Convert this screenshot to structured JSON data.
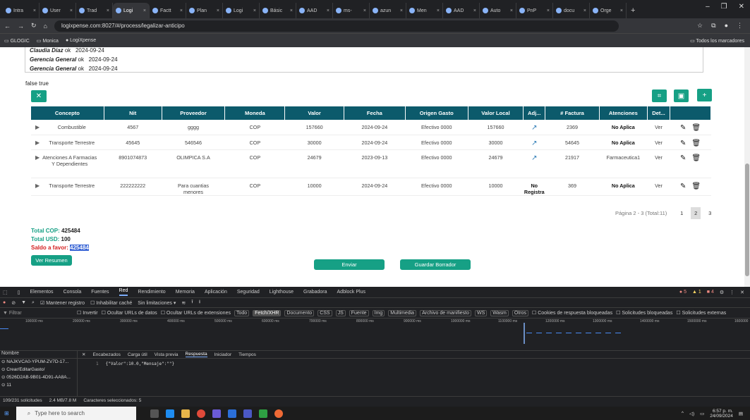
{
  "browser": {
    "tabs": [
      {
        "label": "Intra"
      },
      {
        "label": "User"
      },
      {
        "label": "Trad"
      },
      {
        "label": "Logi",
        "active": true
      },
      {
        "label": "Factt"
      },
      {
        "label": "Plan"
      },
      {
        "label": "Logi"
      },
      {
        "label": "Básic"
      },
      {
        "label": "AAD"
      },
      {
        "label": "ms-"
      },
      {
        "label": "azun"
      },
      {
        "label": "Men"
      },
      {
        "label": "AAD"
      },
      {
        "label": "Auto"
      },
      {
        "label": "PnP"
      },
      {
        "label": "docu"
      },
      {
        "label": "Orge"
      }
    ],
    "new_tab": "+",
    "url": "logixpense.com:8027/#/process/legalizar-anticipo",
    "bookmarks": [
      "GLOGIC",
      "Monica",
      "LogiXpense"
    ],
    "bookmarks_right": "Todos los marcadores"
  },
  "approvals": [
    {
      "name": "Claudia Díaz",
      "status": "ok",
      "date": "2024-09-24"
    },
    {
      "name": "Gerencia General",
      "status": "ok",
      "date": "2024-09-24"
    },
    {
      "name": "Gerencia General",
      "status": "ok",
      "date": "2024-09-24"
    }
  ],
  "flag_text": "false true",
  "table": {
    "headers": [
      "Concepto",
      "Nit",
      "Proveedor",
      "Moneda",
      "Valor",
      "Fecha",
      "Origen Gasto",
      "Valor Local",
      "Adj...",
      "# Factura",
      "Atenciones",
      "Det..."
    ],
    "rows": [
      {
        "concepto": "Combustible",
        "nit": "4567",
        "proveedor": "gggg",
        "moneda": "COP",
        "valor": "157660",
        "fecha": "2024-09-24",
        "origen": "Efectivo 0000",
        "valor_local": "157660",
        "factura": "2369",
        "atenciones": "No Aplica",
        "det": "Ver"
      },
      {
        "concepto": "Transporte Terrestre",
        "nit": "45645",
        "proveedor": "546546",
        "moneda": "COP",
        "valor": "30000",
        "fecha": "2024-09-24",
        "origen": "Efectivo 0000",
        "valor_local": "30000",
        "factura": "54645",
        "atenciones": "No Aplica",
        "det": "Ver"
      },
      {
        "concepto": "Atenciones A Farmacias Y Dependientes",
        "nit": "8901074873",
        "proveedor": "OLIMPICA S.A",
        "moneda": "COP",
        "valor": "24679",
        "fecha": "2023-09-13",
        "origen": "Efectivo 0000",
        "valor_local": "24679",
        "factura": "21917",
        "atenciones": "Farmaceutica1",
        "det": "Ver"
      },
      {
        "concepto": "Transporte Terrestre",
        "nit": "222222222",
        "proveedor": "Para cuantias menores",
        "moneda": "COP",
        "valor": "10000",
        "fecha": "2024-09-24",
        "origen": "Efectivo 0000",
        "valor_local": "10000",
        "adj_text": "No Registra",
        "factura": "369",
        "atenciones": "No Aplica",
        "det": "Ver"
      }
    ]
  },
  "pagination": {
    "info": "Página 2 - 3 (Total:11)",
    "pages": [
      "1",
      "2",
      "3"
    ]
  },
  "totals": {
    "cop_label": "Total COP:",
    "cop": "425484",
    "usd_label": "Total USD:",
    "usd": "100",
    "saldo_label": "Saldo a favor:",
    "saldo": "425484"
  },
  "buttons": {
    "ver_resumen": "Ver Resumen",
    "enviar": "Enviar",
    "guardar": "Guardar Borrador"
  },
  "devtools": {
    "tabs": [
      "Elementos",
      "Consola",
      "Fuentes",
      "Red",
      "Rendimiento",
      "Memoria",
      "Aplicación",
      "Seguridad",
      "Lighthouse",
      "Grabadora",
      "Adblock Plus"
    ],
    "active_tab": "Red",
    "errors": "5",
    "warnings": "1",
    "issues": "4",
    "toolbar": {
      "preserve": "Mantener registro",
      "cache": "Inhabilitar caché",
      "throttle": "Sin limitaciones"
    },
    "filter_placeholder": "Filtrar",
    "filter_items": [
      "Invertir",
      "Ocultar URLs de datos",
      "Ocultar URLs de extensiones"
    ],
    "type_chips": [
      "Todo",
      "Fetch/XHR",
      "Documento",
      "CSS",
      "JS",
      "Fuente",
      "Img",
      "Multimedia",
      "Archivo de manifiesto",
      "WS",
      "Wasm",
      "Otros"
    ],
    "active_chip": "Fetch/XHR",
    "filter_right": [
      "Cookies de respuesta bloqueadas",
      "Solicitudes bloqueadas",
      "Solicitudes externas"
    ],
    "ticks": [
      "100000 ms",
      "200000 ms",
      "300000 ms",
      "400000 ms",
      "500000 ms",
      "600000 ms",
      "700000 ms",
      "800000 ms",
      "900000 ms",
      "1000000 ms",
      "1100000 ms",
      "1200000 ms",
      "1300000 ms",
      "1400000 ms",
      "1500000 ms",
      "1600000"
    ],
    "name_header": "Nombre",
    "requests": [
      "NAJKVCA0-YPUM-ZV7D-17...",
      "Crear/EditarGasto/",
      "0526D2AB-9B01-4D91-AA8A...",
      "11"
    ],
    "resp_tabs": [
      "Encabezados",
      "Carga útil",
      "Vista previa",
      "Respuesta",
      "Iniciador",
      "Tiempos"
    ],
    "active_resp": "Respuesta",
    "response_line": "1",
    "response": "{\"Valor\":10.0,\"Mensaje\":\"\"}",
    "status": [
      "109/231 solicitudes",
      "2.4 MB/7.8 M",
      "Caracteres seleccionados: 5"
    ]
  },
  "taskbar": {
    "search": "Type here to search",
    "time": "6:57 p. m.",
    "date": "24/09/2024"
  }
}
